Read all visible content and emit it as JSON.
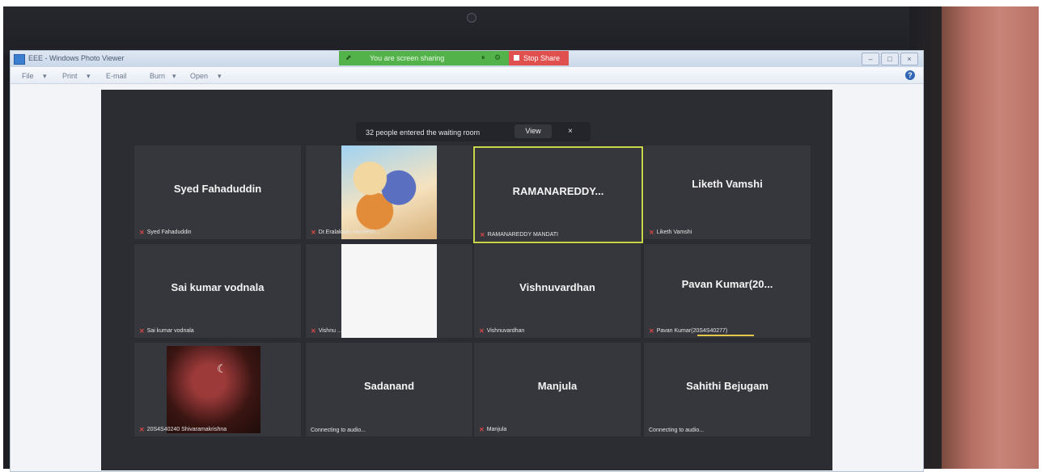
{
  "window": {
    "title": "EEE - Windows Photo Viewer",
    "menu": [
      "File",
      "Print",
      "E-mail",
      "Burn",
      "Open"
    ],
    "help": "?"
  },
  "sharing": {
    "status": "You are screen sharing",
    "stop_label": "Stop Share"
  },
  "waiting_room": {
    "message": "32 people entered the waiting room",
    "view_label": "View",
    "close": "×"
  },
  "participants": [
    {
      "name": "Syed Fahaduddin",
      "label": "Syed Fahaduddin",
      "muted": true,
      "video": "none"
    },
    {
      "name": "",
      "label": "Dr.Eralakadu Haneesh...",
      "muted": true,
      "video": "image"
    },
    {
      "name": "RAMANAREDDY...",
      "label": "RAMANAREDDY MANDATI",
      "muted": true,
      "video": "none",
      "active_speaker": true
    },
    {
      "name": "Liketh Vamshi",
      "label": "Liketh Vamshi",
      "muted": true,
      "video": "none"
    },
    {
      "name": "Sai kumar vodnala",
      "label": "Sai kumar vodnala",
      "muted": true,
      "video": "none"
    },
    {
      "name": "",
      "label": "Vishnu ...",
      "muted": true,
      "video": "white"
    },
    {
      "name": "Vishnuvardhan",
      "label": "Vishnuvardhan",
      "muted": true,
      "video": "none"
    },
    {
      "name": "Pavan Kumar(20...",
      "label": "Pavan Kumar(20S4S40277)",
      "muted": true,
      "video": "none"
    },
    {
      "name": "",
      "label": "20S4S40240 Shivaramakrishna",
      "muted": true,
      "video": "dark"
    },
    {
      "name": "Sadanand",
      "label": "Connecting to audio...",
      "muted": false,
      "video": "none"
    },
    {
      "name": "Manjula",
      "label": "Manjula",
      "muted": true,
      "video": "none"
    },
    {
      "name": "Sahithi Bejugam",
      "label": "Connecting to audio...",
      "muted": false,
      "video": "none"
    }
  ],
  "icons": {
    "mic_muted": "mic-off-icon",
    "moon": "moon-icon"
  }
}
